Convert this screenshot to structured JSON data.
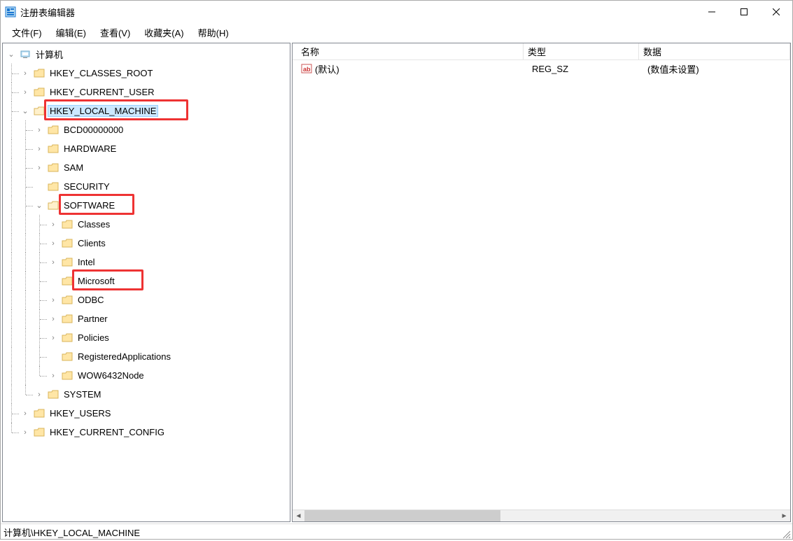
{
  "window": {
    "title": "注册表编辑器"
  },
  "menu": {
    "file": "文件(F)",
    "edit": "编辑(E)",
    "view": "查看(V)",
    "favorites": "收藏夹(A)",
    "help": "帮助(H)"
  },
  "tree": {
    "root": "计算机",
    "hkcr": "HKEY_CLASSES_ROOT",
    "hkcu": "HKEY_CURRENT_USER",
    "hklm": "HKEY_LOCAL_MACHINE",
    "bcd": "BCD00000000",
    "hardware": "HARDWARE",
    "sam": "SAM",
    "security": "SECURITY",
    "software": "SOFTWARE",
    "classes": "Classes",
    "clients": "Clients",
    "intel": "Intel",
    "microsoft": "Microsoft",
    "odbc": "ODBC",
    "partner": "Partner",
    "policies": "Policies",
    "regapps": "RegisteredApplications",
    "wow64": "WOW6432Node",
    "system": "SYSTEM",
    "hku": "HKEY_USERS",
    "hkcc": "HKEY_CURRENT_CONFIG"
  },
  "listview": {
    "cols": {
      "name": "名称",
      "type": "类型",
      "data": "数据"
    },
    "rows": [
      {
        "name": "(默认)",
        "type": "REG_SZ",
        "data": "(数值未设置)"
      }
    ]
  },
  "statusbar": {
    "path": "计算机\\HKEY_LOCAL_MACHINE"
  }
}
